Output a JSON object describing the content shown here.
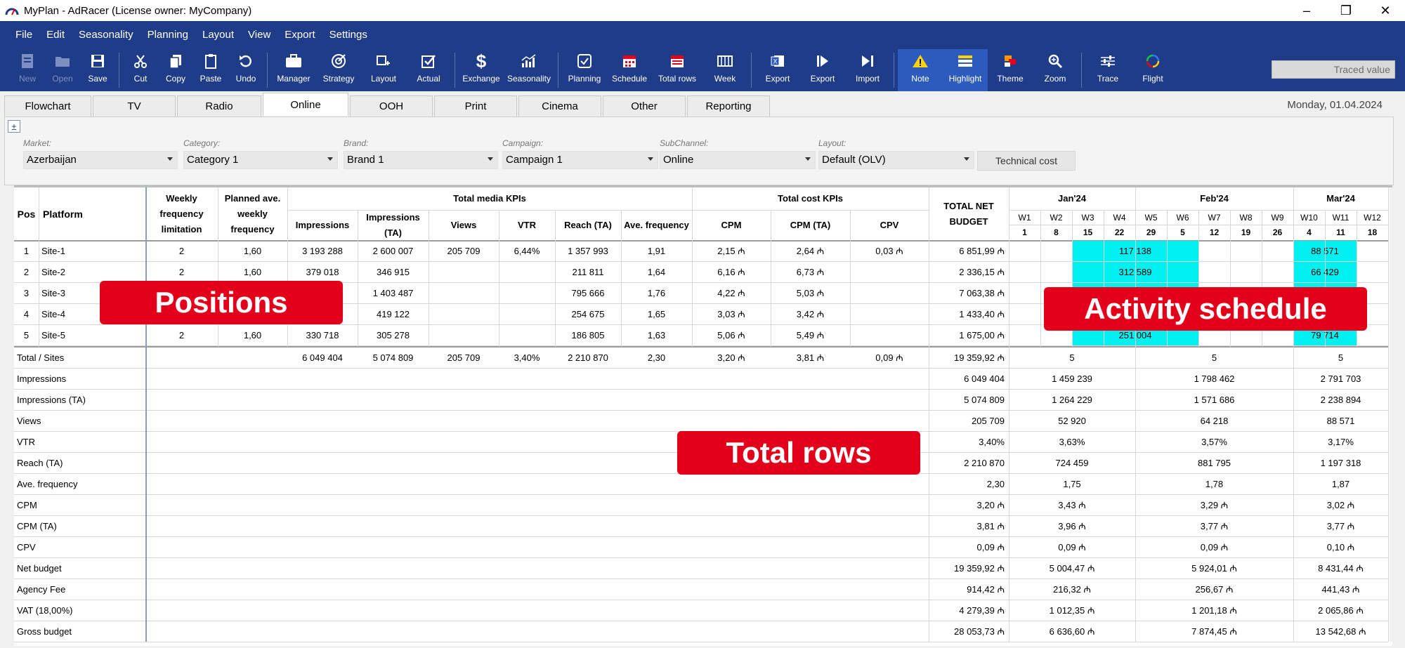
{
  "window": {
    "title": "MyPlan - AdRacer (License owner: MyCompany)"
  },
  "menu": [
    "File",
    "Edit",
    "Seasonality",
    "Planning",
    "Layout",
    "View",
    "Export",
    "Settings"
  ],
  "toolbar": {
    "buttons": [
      {
        "label": "New",
        "icon": "new-doc-icon",
        "disabled": true
      },
      {
        "label": "Open",
        "icon": "folder-icon",
        "disabled": true
      },
      {
        "label": "Save",
        "icon": "floppy-icon"
      },
      {
        "label": "Cut",
        "icon": "scissors-icon"
      },
      {
        "label": "Copy",
        "icon": "copy-icon"
      },
      {
        "label": "Paste",
        "icon": "clipboard-icon"
      },
      {
        "label": "Undo",
        "icon": "undo-icon"
      },
      {
        "label": "Manager",
        "icon": "briefcase-icon"
      },
      {
        "label": "Strategy",
        "icon": "target-icon"
      },
      {
        "label": "Layout",
        "icon": "layout-icon"
      },
      {
        "label": "Actual",
        "icon": "checkbox-icon"
      },
      {
        "label": "Exchange",
        "icon": "dollar-icon"
      },
      {
        "label": "Seasonality",
        "icon": "bar-chart-icon"
      },
      {
        "label": "Planning",
        "icon": "planning-icon"
      },
      {
        "label": "Schedule",
        "icon": "calendar-red-icon"
      },
      {
        "label": "Total rows",
        "icon": "calendar-sum-icon"
      },
      {
        "label": "Week",
        "icon": "week-icon"
      },
      {
        "label": "Export",
        "icon": "excel-icon"
      },
      {
        "label": "Export",
        "icon": "export-arrow-icon"
      },
      {
        "label": "Import",
        "icon": "import-arrow-icon"
      },
      {
        "label": "Note",
        "icon": "warning-icon"
      },
      {
        "label": "Highlight",
        "icon": "highlight-icon"
      },
      {
        "label": "Theme",
        "icon": "theme-icon"
      },
      {
        "label": "Zoom",
        "icon": "zoom-icon"
      },
      {
        "label": "Trace",
        "icon": "sliders-icon"
      },
      {
        "label": "Flight",
        "icon": "flight-icon"
      }
    ],
    "traced_value": "Traced value"
  },
  "tabs": [
    "Flowchart",
    "TV",
    "Radio",
    "Online",
    "OOH",
    "Print",
    "Cinema",
    "Other",
    "Reporting"
  ],
  "active_tab": "Online",
  "date": "Monday, 01.04.2024",
  "filters": [
    {
      "label": "Market:",
      "value": "Azerbaijan"
    },
    {
      "label": "Category:",
      "value": "Category 1"
    },
    {
      "label": "Brand:",
      "value": "Brand 1"
    },
    {
      "label": "Campaign:",
      "value": "Campaign 1"
    },
    {
      "label": "SubChannel:",
      "value": "Online"
    },
    {
      "label": "Layout:",
      "value": "Default (OLV)"
    }
  ],
  "technical_cost": "Technical cost",
  "headers": {
    "pos": "Pos",
    "platform": "Platform",
    "weekly_freq_limit": "Weekly frequency limitation",
    "planned_ave": "Planned ave. weekly frequency",
    "media_group": "Total media KPIs",
    "cost_group": "Total cost KPIs",
    "total_net": "TOTAL NET BUDGET",
    "media_cols": [
      "Impressions",
      "Impressions (TA)",
      "Views",
      "VTR",
      "Reach (TA)",
      "Ave. frequency"
    ],
    "cost_cols": [
      "CPM",
      "CPM (TA)",
      "CPV"
    ],
    "months": [
      "Jan'24",
      "Feb'24",
      "Mar'24"
    ],
    "weeks": [
      "W1",
      "W2",
      "W3",
      "W4",
      "W5",
      "W6",
      "W7",
      "W8",
      "W9",
      "W10",
      "W11",
      "W12"
    ],
    "days": [
      "1",
      "8",
      "15",
      "22",
      "29",
      "5",
      "12",
      "19",
      "26",
      "4",
      "11",
      "18"
    ]
  },
  "positions": [
    {
      "pos": "1",
      "platform": "Site-1",
      "wfl": "2",
      "paf": "1,60",
      "impr": "3 193 288",
      "impr_ta": "2 600 007",
      "views": "205 709",
      "vtr": "6,44%",
      "reach": "1 357 993",
      "avefreq": "1,91",
      "cpm": "2,15 ₼",
      "cpm_ta": "2,64 ₼",
      "cpv": "0,03 ₼",
      "budget": "6 851,99 ₼",
      "bars": [
        {
          "from": 2,
          "to": 6,
          "label": "117 138"
        },
        {
          "from": 9,
          "to": 11,
          "label": "88 571"
        }
      ]
    },
    {
      "pos": "2",
      "platform": "Site-2",
      "wfl": "2",
      "paf": "1,60",
      "impr": "379 018",
      "impr_ta": "346 915",
      "views": "",
      "vtr": "",
      "reach": "211 811",
      "avefreq": "1,64",
      "cpm": "6,16 ₼",
      "cpm_ta": "6,73 ₼",
      "cpv": "",
      "budget": "2 336,15 ₼",
      "bars": [
        {
          "from": 2,
          "to": 6,
          "label": "312 589"
        },
        {
          "from": 9,
          "to": 11,
          "label": "66 429"
        }
      ]
    },
    {
      "pos": "3",
      "platform": "Site-3",
      "wfl": "",
      "paf": "",
      "impr": "",
      "impr_ta": "1 403 487",
      "views": "",
      "vtr": "",
      "reach": "795 666",
      "avefreq": "1,76",
      "cpm": "4,22 ₼",
      "cpm_ta": "5,03 ₼",
      "cpv": "",
      "budget": "7 063,38 ₼",
      "bars": [
        {
          "from": 2,
          "to": 6,
          "label": ""
        },
        {
          "from": 9,
          "to": 11,
          "label": ""
        }
      ]
    },
    {
      "pos": "4",
      "platform": "Site-4",
      "wfl": "",
      "paf": "",
      "impr": "",
      "impr_ta": "419 122",
      "views": "",
      "vtr": "",
      "reach": "254 675",
      "avefreq": "1,65",
      "cpm": "3,03 ₼",
      "cpm_ta": "3,42 ₼",
      "cpv": "",
      "budget": "1 433,40 ₼",
      "bars": [
        {
          "from": 2,
          "to": 6,
          "label": ""
        },
        {
          "from": 9,
          "to": 11,
          "label": ""
        }
      ]
    },
    {
      "pos": "5",
      "platform": "Site-5",
      "wfl": "2",
      "paf": "1,60",
      "impr": "330 718",
      "impr_ta": "305 278",
      "views": "",
      "vtr": "",
      "reach": "186 805",
      "avefreq": "1,63",
      "cpm": "5,06 ₼",
      "cpm_ta": "5,49 ₼",
      "cpv": "",
      "budget": "1 675,00 ₼",
      "bars": [
        {
          "from": 2,
          "to": 6,
          "label": "251 004"
        },
        {
          "from": 9,
          "to": 11,
          "label": "79 714"
        }
      ]
    }
  ],
  "total_sites": {
    "label": "Total / Sites",
    "impr": "6 049 404",
    "impr_ta": "5 074 809",
    "views": "205 709",
    "vtr": "3,40%",
    "reach": "2 210 870",
    "avefreq": "2,30",
    "cpm": "3,20 ₼",
    "cpm_ta": "3,81 ₼",
    "cpv": "0,09 ₼",
    "budget": "19 359,92 ₼",
    "months": [
      "5",
      "5",
      "5"
    ]
  },
  "total_rows": [
    {
      "label": "Impressions",
      "total": "6 049 404",
      "months": [
        "1 459 239",
        "1 798 462",
        "2 791 703"
      ]
    },
    {
      "label": "Impressions (TA)",
      "total": "5 074 809",
      "months": [
        "1 264 229",
        "1 571 686",
        "2 238 894"
      ]
    },
    {
      "label": "Views",
      "total": "205 709",
      "months": [
        "52 920",
        "64 218",
        "88 571"
      ]
    },
    {
      "label": "VTR",
      "total": "3,40%",
      "months": [
        "3,63%",
        "3,57%",
        "3,17%"
      ]
    },
    {
      "label": "Reach (TA)",
      "total": "2 210 870",
      "months": [
        "724 459",
        "881 795",
        "1 197 318"
      ]
    },
    {
      "label": "Ave. frequency",
      "total": "2,30",
      "months": [
        "1,75",
        "1,78",
        "1,87"
      ]
    },
    {
      "label": "CPM",
      "total": "3,20 ₼",
      "months": [
        "3,43 ₼",
        "3,29 ₼",
        "3,02 ₼"
      ]
    },
    {
      "label": "CPM (TA)",
      "total": "3,81 ₼",
      "months": [
        "3,96 ₼",
        "3,77 ₼",
        "3,77 ₼"
      ]
    },
    {
      "label": "CPV",
      "total": "0,09 ₼",
      "months": [
        "0,09 ₼",
        "0,09 ₼",
        "0,10 ₼"
      ]
    },
    {
      "label": "Net budget",
      "total": "19 359,92 ₼",
      "months": [
        "5 004,47 ₼",
        "5 924,01 ₼",
        "8 431,44 ₼"
      ]
    },
    {
      "label": "Agency Fee",
      "total": "914,42 ₼",
      "months": [
        "216,32 ₼",
        "256,67 ₼",
        "441,43 ₼"
      ]
    },
    {
      "label": "VAT (18,00%)",
      "total": "4 279,39 ₼",
      "months": [
        "1 012,35 ₼",
        "1 201,18 ₼",
        "2 065,86 ₼"
      ]
    },
    {
      "label": "Gross budget",
      "total": "28 053,73 ₼",
      "months": [
        "6 636,60 ₼",
        "7 874,45 ₼",
        "13 542,68 ₼"
      ]
    }
  ],
  "overlays": {
    "positions": "Positions",
    "activity": "Activity schedule",
    "total_rows": "Total rows"
  },
  "colors": {
    "accent": "#1f3c88",
    "schedule_bar": "#00f0f0",
    "overlay": "#e3001b"
  }
}
